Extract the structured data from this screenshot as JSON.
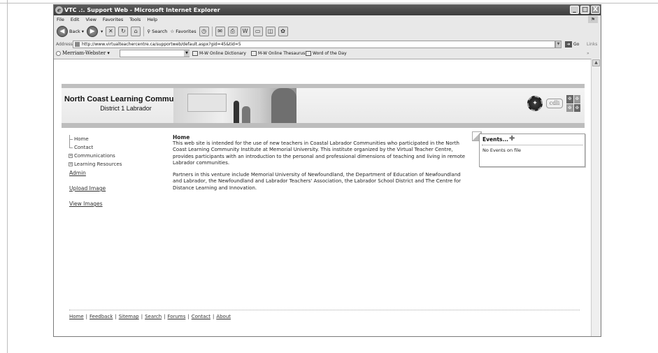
{
  "window": {
    "title": "VTC .:. Support Web - Microsoft Internet Explorer",
    "controls": [
      "_",
      "□",
      "X"
    ]
  },
  "menubar": {
    "items": [
      "File",
      "Edit",
      "View",
      "Favorites",
      "Tools",
      "Help"
    ]
  },
  "toolbar": {
    "back_label": "Back",
    "search_label": "Search",
    "favorites_label": "Favorites"
  },
  "addressbar": {
    "label": "Address",
    "url": "http://www.virtualteachercentre.ca/supportweb/default.aspx?gid=45&tid=5",
    "go_label": "Go",
    "links_label": "Links »"
  },
  "mw_toolbar": {
    "title": "Merriam-Webster ▾",
    "links": [
      "M-W Online Dictionary",
      "M-W Online Thesaurus",
      "Word of the Day"
    ]
  },
  "site": {
    "title": "North Coast Learning Community",
    "subtitle": "District 1 Labrador",
    "logo_text": "cdli"
  },
  "nav_tree": {
    "items": [
      "Home",
      "Contact",
      "Communications",
      "Learning Resources"
    ],
    "expanders": [
      "⊞",
      "⊞"
    ]
  },
  "side_links": [
    "Admin",
    "Upload Image",
    "View Images"
  ],
  "content": {
    "heading": "Home",
    "paragraphs": [
      "This web site is intended for the use of new teachers in Coastal Labrador Communities who participated in the North Coast Learning Community Institute at Memorial University. This institute organized by the Virtual Teacher Centre, provides participants with an introduction to the personal and professional dimensions of teaching and living in remote Labrador communities.",
      "Partners in this venture include Memorial University of Newfoundland, the Department of Education of Newfoundland and Labrador, the Newfoundland and Labrador Teachers' Association, the Labrador School District and The Centre for Distance Learning and Innovation."
    ]
  },
  "events": {
    "title": "Events...",
    "add_symbol": "✚",
    "empty_text": "No Events on file"
  },
  "footer": {
    "links": [
      "Home",
      "Feedback",
      "Sitemap",
      "Search",
      "Forums",
      "Contact",
      "About"
    ],
    "separator": "|"
  }
}
